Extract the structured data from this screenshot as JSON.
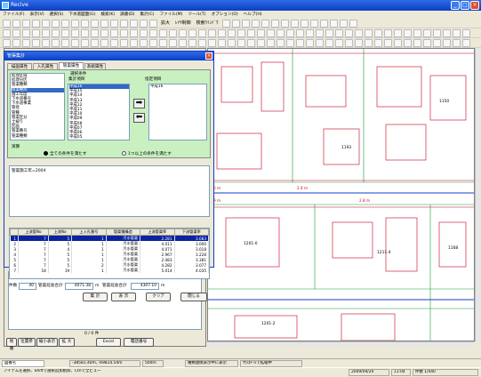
{
  "window": {
    "title": "Recive"
  },
  "menu": [
    "ファイル(F)",
    "表示(V)",
    "選択(S)",
    "下水道図面(G)",
    "検索(K)",
    "調書(D)",
    "集計(C)",
    "ファイル(M)",
    "ツール(T)",
    "オプション(O)",
    "ヘルプ(H)"
  ],
  "toolbar1": {
    "text_items": [
      "拡大",
      "ﾚｲﾔ制御",
      "検索ｳｲﾝﾄﾞｳ"
    ]
  },
  "dialog": {
    "title": "管渠集計",
    "tabs": [
      "描画属性",
      "入孔属性",
      "管渠属性",
      "系統属性"
    ],
    "condition_label": "選択条件",
    "display_items_label": "集計項目",
    "summary_items_label": "指定項目",
    "left_list": [
      "処理区域",
      "処理分区",
      "管渠種類",
      "管渠種別",
      "施工年度",
      "下水道番号",
      "下水道事業",
      "管径",
      "管種",
      "管渠区分",
      "土被り",
      "区画",
      "管渠番号",
      "管渠種類"
    ],
    "left_list_selected": 3,
    "middle_list": [
      "平成16",
      "平成15",
      "平成14",
      "平成13",
      "平成12",
      "平成11",
      "平成10",
      "平成09",
      "平成08",
      "平成07",
      "平成06",
      "平成05"
    ],
    "middle_list_selected": 0,
    "right_list": [
      "平成16"
    ],
    "operator_label": "演算",
    "radio_all": "全ての条件を満たす",
    "radio_any": "1つ以上の条件を満たす",
    "condition_text": "管渠施工年=2004",
    "grid_headers": [
      "",
      "上流管No",
      "上流No",
      "上入孔番号",
      "管渠種構造",
      "上流管渠率",
      "下流管渠率"
    ],
    "grid_rows": [
      [
        "1",
        "7",
        "5",
        "1",
        "汚水管渠",
        "2.281",
        "3.083"
      ],
      [
        "2",
        "7",
        "5",
        "1",
        "汚水管渠",
        "4.011",
        "3.000"
      ],
      [
        "3",
        "7",
        "4",
        "1",
        "汚水管渠",
        "4.071",
        "3.018"
      ],
      [
        "4",
        "7",
        "5",
        "1",
        "汚水管渠",
        "2.967",
        "3.228"
      ],
      [
        "5",
        "7",
        "5",
        "1",
        "汚水管渠",
        "2.483",
        "3.381"
      ],
      [
        "6",
        "7",
        "5",
        "2",
        "汚水管渠",
        "4.282",
        "3.077"
      ],
      [
        "7",
        "18",
        "19",
        "1",
        "汚水管渠",
        "5.014",
        "4.035"
      ]
    ],
    "count_label": "件数",
    "count_value": "40",
    "total_label": "管渠延長合計",
    "total_value": "4071.38",
    "sum_label": "管渠延長合計",
    "sum_value": "4307.10",
    "unit": "m",
    "buttons": [
      "集 計",
      "表 示",
      "クリア",
      "閉じる"
    ]
  },
  "leftpanel": {
    "page_count": "0 / 0 件",
    "buttons": [
      "地 番",
      "位置参",
      "縮小表示",
      "拡 大",
      "Excel",
      "電話番号"
    ]
  },
  "map": {
    "labels": [
      "1201-0",
      "1201-1",
      "1201-2",
      "1202-2",
      "1211-4",
      "1203",
      "1231",
      "1193",
      "1176",
      "1150",
      "1168"
    ],
    "road_labels": [
      "2.0 m",
      "1.9 m",
      "2.8 m",
      "2.4 m"
    ]
  },
  "status": {
    "combo": "図番名",
    "coords": "-38581.40m,  -69814.54m",
    "scale": "500m",
    "message": "種類連携表示中に表示",
    "date": "2009/09/24",
    "time": "11:04",
    "total": "件数 1/440",
    "hint": "アイテムを選択、Shiftで選択追加削除、Ctrlで全ビュー",
    "hint2": "ﾏｳｽﾎｲｰﾙで拡縮中"
  },
  "colors": {
    "titlebar": "#0a3fc4",
    "map_lines": "#c8001e",
    "map_green": "#1a9a3a",
    "grid_highlight": "#0a24a0",
    "green_panel": "#c8f0c0"
  }
}
